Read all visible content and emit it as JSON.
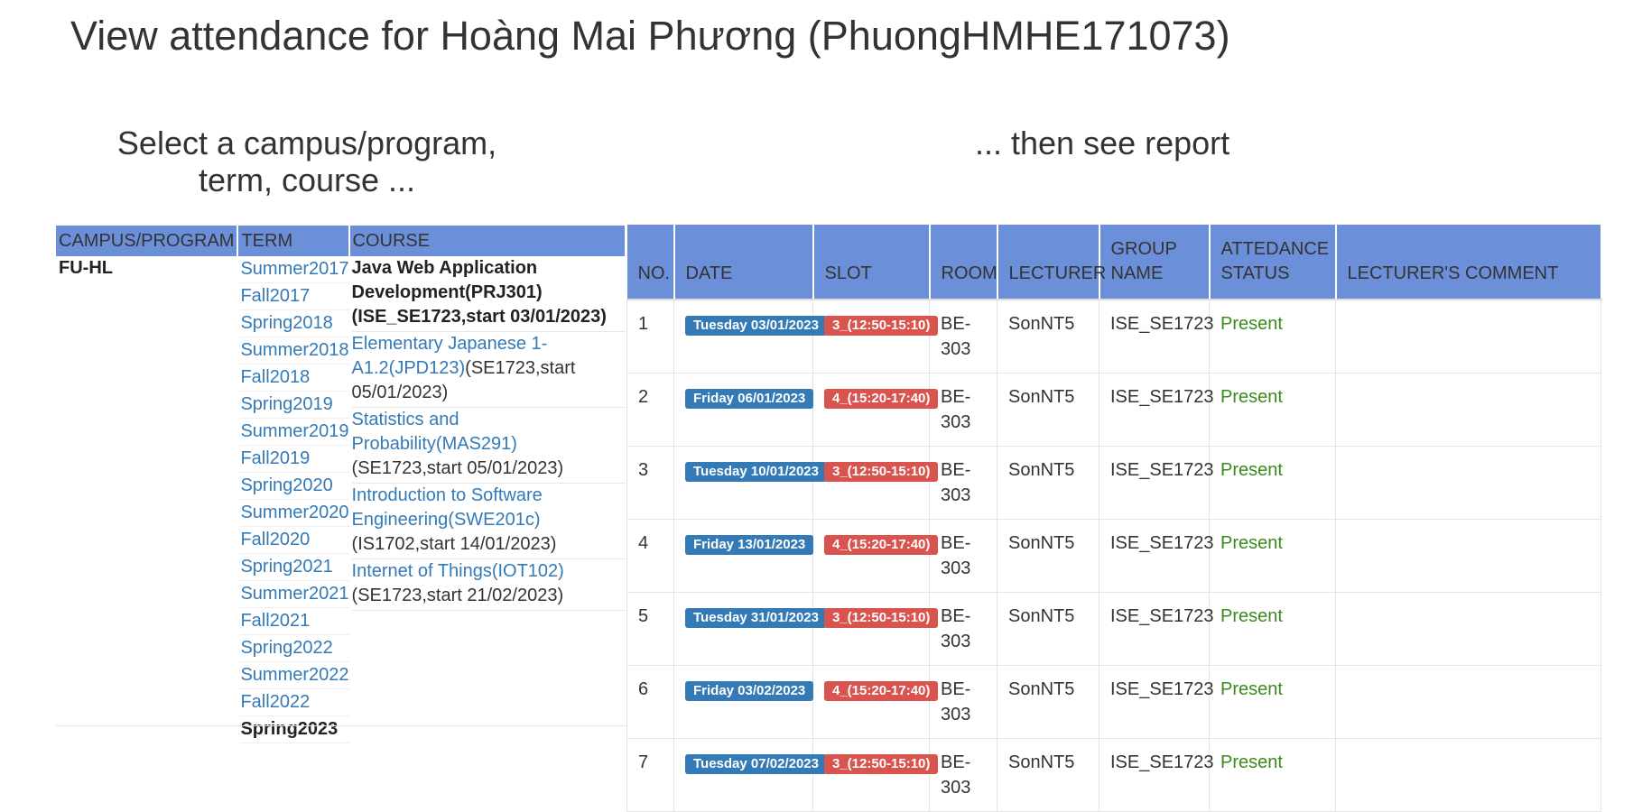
{
  "page": {
    "title": "View attendance for Hoàng Mai Phương (PhuongHMHE171073)",
    "left_heading": "Select a campus/program, term, course ...",
    "right_heading": "... then see report"
  },
  "selector": {
    "headers": {
      "campus": "CAMPUS/PROGRAM",
      "term": "TERM",
      "course": "COURSE"
    },
    "campus": "FU-HL",
    "terms": [
      "Summer2017",
      "Fall2017",
      "Spring2018",
      "Summer2018",
      "Fall2018",
      "Spring2019",
      "Summer2019",
      "Fall2019",
      "Spring2020",
      "Summer2020",
      "Fall2020",
      "Spring2021",
      "Summer2021",
      "Fall2021",
      "Spring2022",
      "Summer2022",
      "Fall2022"
    ],
    "current_term": "Spring2023",
    "courses": [
      {
        "name": "Java Web Application Development(PRJ301) (ISE_SE1723,start 03/01/2023)",
        "selected": true
      },
      {
        "name": "Elementary Japanese 1-A1.2(JPD123)",
        "extra": "(SE1723,start 05/01/2023)"
      },
      {
        "name": "Statistics and Probability(MAS291)",
        "extra": "(SE1723,start 05/01/2023)"
      },
      {
        "name": "Introduction to Software Engineering(SWE201c)",
        "extra": "(IS1702,start 14/01/2023)"
      },
      {
        "name": "Internet of Things(IOT102)",
        "extra": "(SE1723,start 21/02/2023)"
      }
    ]
  },
  "report": {
    "headers": [
      "NO.",
      "DATE",
      "SLOT",
      "ROOM",
      "LECTURER",
      "GROUP NAME",
      "ATTEDANCE STATUS",
      "LECTURER'S COMMENT"
    ],
    "rows": [
      {
        "no": "1",
        "date": "Tuesday 03/01/2023",
        "slot": "3_(12:50-15:10)",
        "room": "BE-303",
        "lecturer": "SonNT5",
        "group": "ISE_SE1723",
        "status": "Present",
        "comment": ""
      },
      {
        "no": "2",
        "date": "Friday 06/01/2023",
        "slot": "4_(15:20-17:40)",
        "room": "BE-303",
        "lecturer": "SonNT5",
        "group": "ISE_SE1723",
        "status": "Present",
        "comment": ""
      },
      {
        "no": "3",
        "date": "Tuesday 10/01/2023",
        "slot": "3_(12:50-15:10)",
        "room": "BE-303",
        "lecturer": "SonNT5",
        "group": "ISE_SE1723",
        "status": "Present",
        "comment": ""
      },
      {
        "no": "4",
        "date": "Friday 13/01/2023",
        "slot": "4_(15:20-17:40)",
        "room": "BE-303",
        "lecturer": "SonNT5",
        "group": "ISE_SE1723",
        "status": "Present",
        "comment": ""
      },
      {
        "no": "5",
        "date": "Tuesday 31/01/2023",
        "slot": "3_(12:50-15:10)",
        "room": "BE-303",
        "lecturer": "SonNT5",
        "group": "ISE_SE1723",
        "status": "Present",
        "comment": ""
      },
      {
        "no": "6",
        "date": "Friday 03/02/2023",
        "slot": "4_(15:20-17:40)",
        "room": "BE-303",
        "lecturer": "SonNT5",
        "group": "ISE_SE1723",
        "status": "Present",
        "comment": ""
      },
      {
        "no": "7",
        "date": "Tuesday 07/02/2023",
        "slot": "3_(12:50-15:10)",
        "room": "BE-303",
        "lecturer": "SonNT5",
        "group": "ISE_SE1723",
        "status": "Present",
        "comment": ""
      }
    ]
  }
}
